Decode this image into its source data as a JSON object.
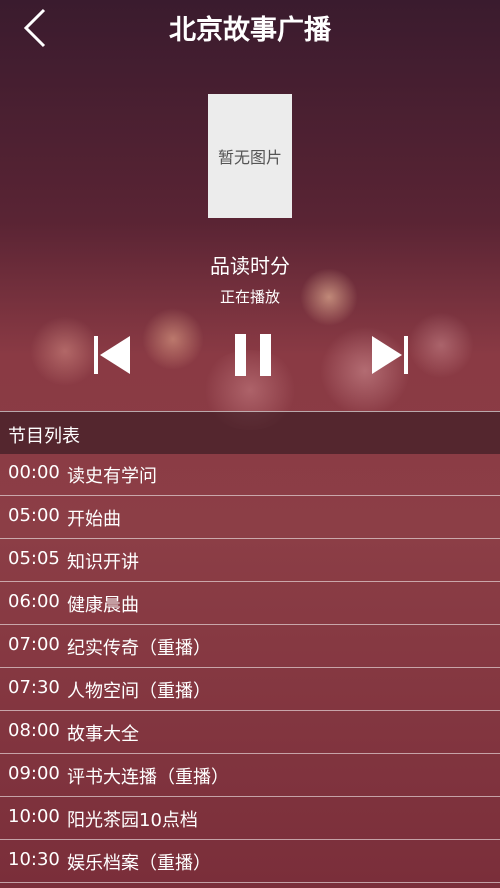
{
  "header": {
    "title": "北京故事广播",
    "back_icon": "chevron-left-icon"
  },
  "cover": {
    "placeholder_text": "暂无图片"
  },
  "now_playing": {
    "program": "品读时分",
    "status": "正在播放"
  },
  "controls": {
    "prev_icon": "skip-previous-icon",
    "pause_icon": "pause-icon",
    "next_icon": "skip-next-icon"
  },
  "list": {
    "header": "节目列表",
    "items": [
      {
        "time": "00:00",
        "name": "读史有学问"
      },
      {
        "time": "05:00",
        "name": "开始曲"
      },
      {
        "time": "05:05",
        "name": "知识开讲"
      },
      {
        "time": "06:00",
        "name": "健康晨曲"
      },
      {
        "time": "07:00",
        "name": "纪实传奇（重播）"
      },
      {
        "time": "07:30",
        "name": "人物空间（重播）"
      },
      {
        "time": "08:00",
        "name": "故事大全"
      },
      {
        "time": "09:00",
        "name": "评书大连播（重播）"
      },
      {
        "time": "10:00",
        "name": "阳光茶园10点档"
      },
      {
        "time": "10:30",
        "name": "娱乐档案（重播）"
      }
    ]
  }
}
